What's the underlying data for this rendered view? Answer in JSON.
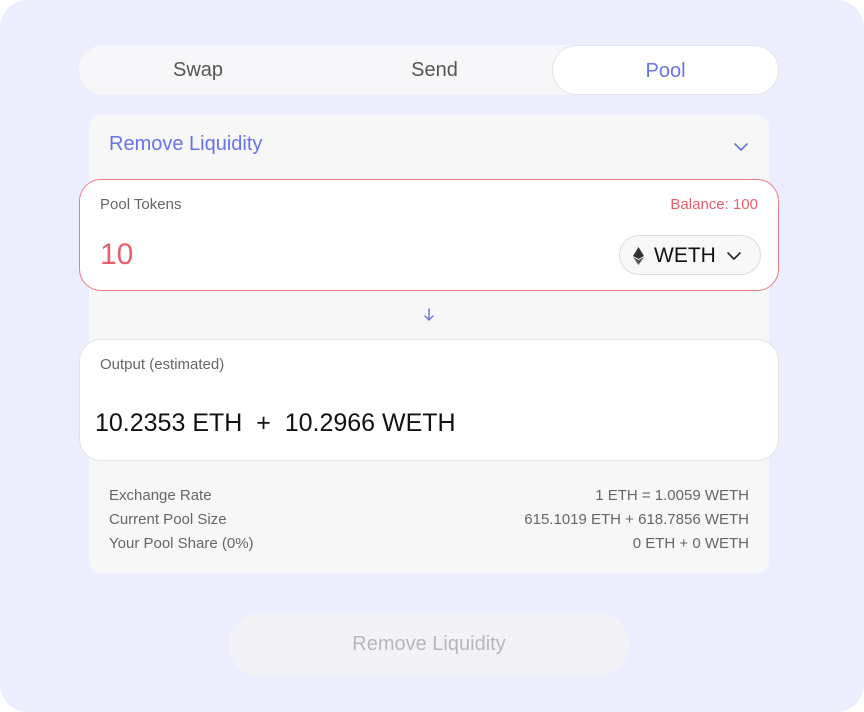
{
  "tabs": [
    {
      "label": "Swap"
    },
    {
      "label": "Send"
    },
    {
      "label": "Pool"
    }
  ],
  "active_tab": "Pool",
  "section": {
    "title": "Remove Liquidity",
    "chevron": "chevron-down-icon"
  },
  "input": {
    "label": "Pool Tokens",
    "balance": "Balance: 100",
    "value": "10",
    "token": "WETH",
    "token_icon": "ethereum-icon"
  },
  "output": {
    "label": "Output (estimated)",
    "values": "10.2353 ETH  +  10.2966 WETH"
  },
  "details": [
    {
      "label": "Exchange Rate",
      "value": "1 ETH = 1.0059 WETH"
    },
    {
      "label": "Current Pool Size",
      "value": "615.1019 ETH + 618.7856 WETH"
    },
    {
      "label": "Your Pool Share (0%)",
      "value": "0 ETH + 0 WETH"
    }
  ],
  "submit_label": "Remove Liquidity",
  "colors": {
    "accent": "#6873e6",
    "error": "#e6606d",
    "background": "#eceefe"
  }
}
